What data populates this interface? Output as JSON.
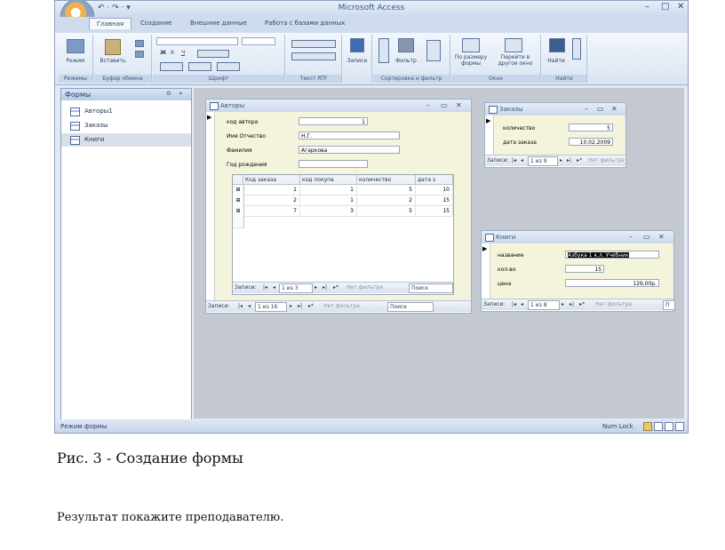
{
  "window": {
    "title": "Microsoft Access",
    "quick_access": "↶ · ↷ · ▾",
    "controls": [
      "–",
      "□",
      "✕"
    ]
  },
  "ribbon": {
    "tabs": [
      "Главная",
      "Создание",
      "Внешние данные",
      "Работа с базами данных"
    ],
    "groups": {
      "views": {
        "label": "Режимы",
        "button": "Режим"
      },
      "clipboard": {
        "label": "Буфер обмена",
        "button": "Вставить"
      },
      "font": {
        "label": "Шрифт",
        "buttons": [
          "Ж",
          "К",
          "Ч"
        ]
      },
      "rtf": {
        "label": "Текст RTF"
      },
      "records": {
        "button": "Записи"
      },
      "sort": {
        "label": "Сортировка и фильтр",
        "button": "Фильтр"
      },
      "window": {
        "label": "Окно",
        "buttons": [
          "По размеру формы",
          "Перейти в другое окно"
        ]
      },
      "find": {
        "label": "Найти",
        "button": "Найти"
      }
    }
  },
  "nav_pane": {
    "title": "Формы",
    "items": [
      "Авторы1",
      "Заказы",
      "Книги"
    ],
    "selected_index": 2
  },
  "forms": {
    "authors": {
      "title": "Авторы",
      "fields": [
        {
          "label": "код автора",
          "value": "1"
        },
        {
          "label": "Имя Отчество",
          "value": "Н.Г."
        },
        {
          "label": "Фамилия",
          "value": "Агаркова"
        },
        {
          "label": "Год рождения",
          "value": ""
        }
      ],
      "subform": {
        "columns": [
          "Код заказа",
          "код покупа",
          "количество",
          "дата з"
        ],
        "rows": [
          [
            "1",
            "1",
            "5",
            "10"
          ],
          [
            "2",
            "1",
            "2",
            "15"
          ],
          [
            "7",
            "3",
            "5",
            "15"
          ]
        ],
        "nav": {
          "label": "Записи:",
          "position": "1 из 3",
          "filter": "Нет фильтра",
          "search": "Поиск"
        }
      },
      "nav": {
        "label": "Записи:",
        "position": "1 из 16",
        "filter": "Нет фильтра",
        "search": "Поиск"
      }
    },
    "orders": {
      "title": "Заказы",
      "fields": [
        {
          "label": "количество",
          "value": "5"
        },
        {
          "label": "дата заказа",
          "value": "10.02.2009"
        }
      ],
      "nav": {
        "label": "Записи:",
        "position": "1 из 9",
        "filter": "Нет фильтра"
      }
    },
    "books": {
      "title": "Книги",
      "fields": [
        {
          "label": "название",
          "value": "Азбука 1 к.л. Учебник"
        },
        {
          "label": "кол-во",
          "value": "15"
        },
        {
          "label": "цена",
          "value": "129,00р."
        }
      ],
      "nav": {
        "label": "Записи:",
        "position": "1 из 8",
        "filter": "Нет фильтра",
        "search": "П"
      }
    }
  },
  "status_bar": {
    "mode": "Режим формы",
    "numlock": "Num Lock"
  },
  "caption": "Рис. 3 - Создание формы",
  "note": "Результат покажите преподавателю."
}
